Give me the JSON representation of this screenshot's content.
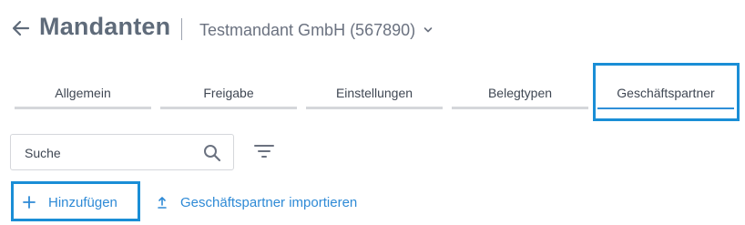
{
  "header": {
    "title": "Mandanten",
    "tenant_selector": "Testmandant GmbH (567890)"
  },
  "tabs": [
    {
      "label": "Allgemein",
      "active": false
    },
    {
      "label": "Freigabe",
      "active": false
    },
    {
      "label": "Einstellungen",
      "active": false
    },
    {
      "label": "Belegtypen",
      "active": false
    },
    {
      "label": "Geschäftspartner",
      "active": true
    }
  ],
  "search": {
    "placeholder": "Suche",
    "value": ""
  },
  "actions": {
    "add_label": "Hinzufügen",
    "import_label": "Geschäftspartner importieren"
  },
  "colors": {
    "accent": "#2e8ad6",
    "highlight_border": "#1a8ed6",
    "title": "#5f6b7a",
    "tab_inactive_underline": "#d5d7da"
  },
  "icons": [
    "back-arrow-icon",
    "chevron-down-icon",
    "search-icon",
    "filter-icon",
    "plus-icon",
    "upload-icon"
  ]
}
